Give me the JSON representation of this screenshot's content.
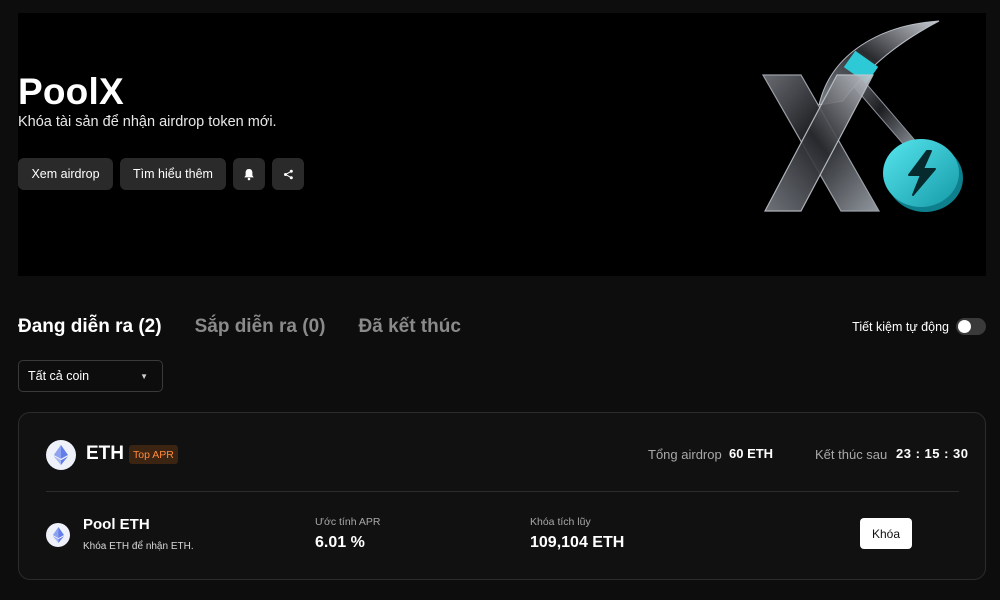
{
  "hero": {
    "title": "PoolX",
    "subtitle": "Khóa tài sản để nhận airdrop token mới.",
    "buttons": {
      "view_airdrop": "Xem airdrop",
      "learn_more": "Tìm hiểu thêm",
      "notify_icon": "bell-icon",
      "share_icon": "share-icon"
    },
    "logo_icons": [
      "x-logo",
      "bolt-coin-icon"
    ]
  },
  "tabs": [
    {
      "label": "Đang diễn ra (2)",
      "active": true
    },
    {
      "label": "Sắp diễn ra (0)",
      "active": false
    },
    {
      "label": "Đã kết thúc",
      "active": false
    }
  ],
  "auto_save": {
    "label": "Tiết kiệm tự động",
    "enabled": false
  },
  "filter": {
    "selected": "Tất cả coin",
    "icon": "caret-down-icon"
  },
  "card": {
    "coin": "ETH",
    "coin_icon": "ethereum-icon",
    "badge": "Top APR",
    "total_airdrop_label": "Tổng airdrop",
    "total_airdrop_value": "60 ETH",
    "ends_in_label": "Kết thúc sau",
    "ends_in_value": "23 : 15 : 30",
    "pool": {
      "name": "Pool ETH",
      "description": "Khóa ETH để nhận ETH.",
      "apr_label": "Ước tính APR",
      "apr_value": "6.01 %",
      "locked_label": "Khóa tích lũy",
      "locked_value": "109,104 ETH",
      "action_label": "Khóa"
    }
  },
  "colors": {
    "background": "#0d0d0d",
    "hero_background": "#000000",
    "accent_cyan": "#2ec9d6",
    "badge_text": "#ff8a3d",
    "badge_bg": "#3b2412",
    "muted_text": "#8a8a8a"
  }
}
